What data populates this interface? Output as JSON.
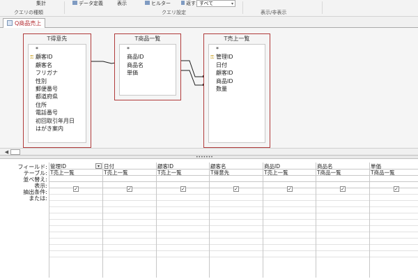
{
  "ribbon": {
    "items": {
      "totals": "集計",
      "datasheet": "データ定義",
      "show_hide": "表示",
      "filter": "ヒルター",
      "return_label": "返す:",
      "return_value": "すべて"
    },
    "groups": {
      "query_type": "クエリの種類",
      "query_setup": "クエリ設定",
      "show_hide": "表示/非表示"
    }
  },
  "document_tab": {
    "label": "Q商品売上"
  },
  "tables": [
    {
      "title": "T得意先",
      "fields": [
        {
          "name": "*",
          "key": false
        },
        {
          "name": "顧客ID",
          "key": true
        },
        {
          "name": "顧客名",
          "key": false
        },
        {
          "name": "フリガナ",
          "key": false
        },
        {
          "name": "性別",
          "key": false
        },
        {
          "name": "郵便番号",
          "key": false
        },
        {
          "name": "都道府県",
          "key": false
        },
        {
          "name": "住所",
          "key": false
        },
        {
          "name": "電話番号",
          "key": false
        },
        {
          "name": "初回取引年月日",
          "key": false
        },
        {
          "name": "はがき案内",
          "key": false
        }
      ]
    },
    {
      "title": "T商品一覧",
      "fields": [
        {
          "name": "*",
          "key": false
        },
        {
          "name": "商品ID",
          "key": false
        },
        {
          "name": "商品名",
          "key": false
        },
        {
          "name": "単価",
          "key": false
        }
      ]
    },
    {
      "title": "T売上一覧",
      "fields": [
        {
          "name": "*",
          "key": false
        },
        {
          "name": "管理ID",
          "key": true
        },
        {
          "name": "日付",
          "key": false
        },
        {
          "name": "顧客ID",
          "key": false
        },
        {
          "name": "商品ID",
          "key": false
        },
        {
          "name": "数量",
          "key": false
        }
      ]
    }
  ],
  "grid": {
    "row_labels": {
      "field": "フィールド:",
      "table": "テーブル:",
      "sort": "並べ替え:",
      "show": "表示:",
      "criteria": "抽出条件:",
      "or": "または:"
    },
    "columns": [
      {
        "field": "管理ID",
        "table": "T売上一覧",
        "show": true
      },
      {
        "field": "日付",
        "table": "T売上一覧",
        "show": true
      },
      {
        "field": "顧客ID",
        "table": "T売上一覧",
        "show": true
      },
      {
        "field": "顧客名",
        "table": "T得意先",
        "show": true
      },
      {
        "field": "商品ID",
        "table": "T売上一覧",
        "show": true
      },
      {
        "field": "商品名",
        "table": "T商品一覧",
        "show": true
      },
      {
        "field": "単価",
        "table": "T商品一覧",
        "show": true
      }
    ]
  }
}
